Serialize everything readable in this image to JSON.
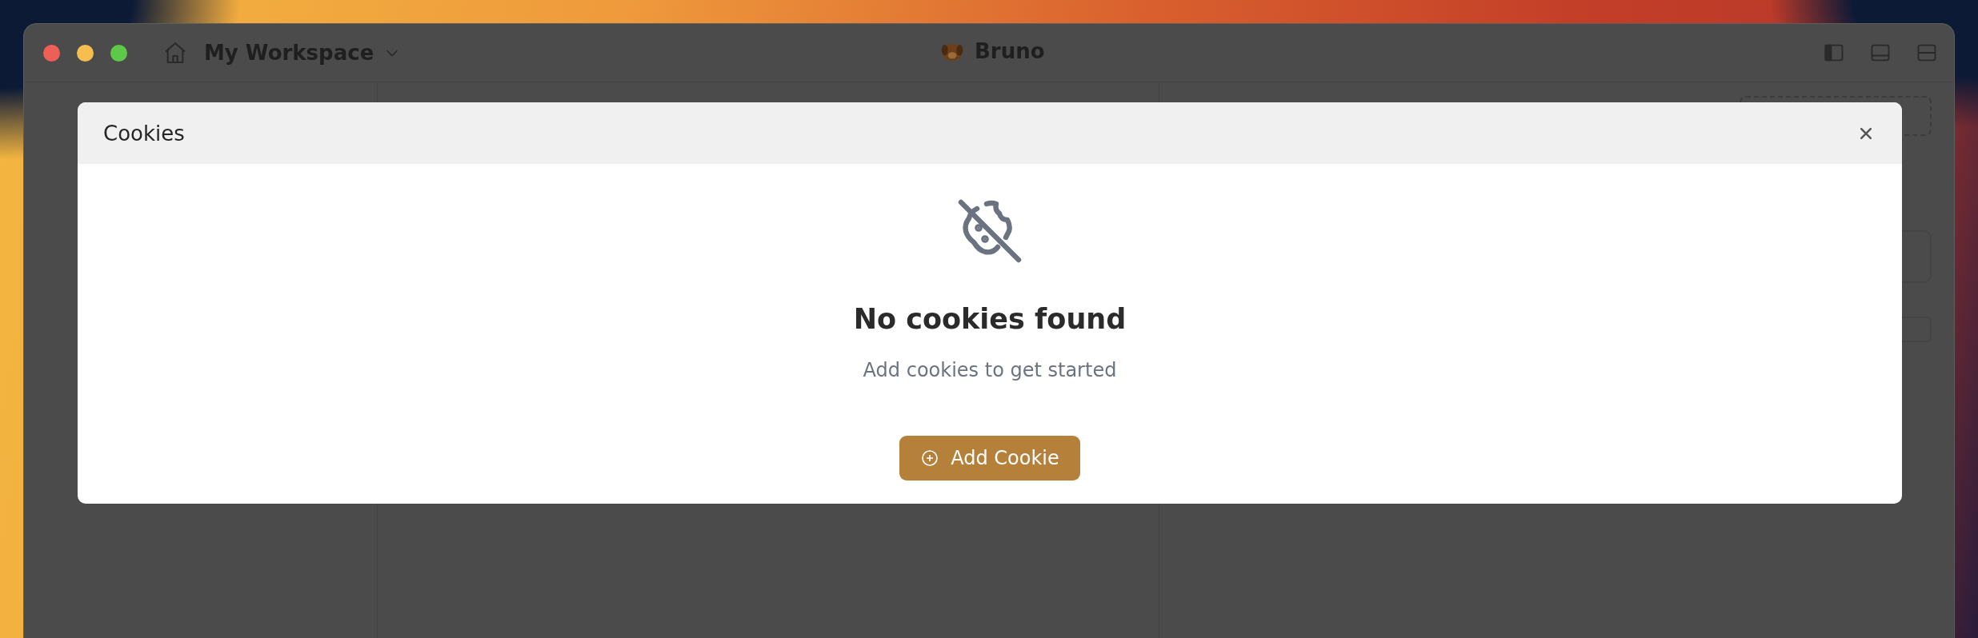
{
  "window": {
    "workspace": "My Workspace",
    "app_title": "Bruno"
  },
  "dialog": {
    "title": "Cookies",
    "empty_state": {
      "heading": "No cookies found",
      "message": "Add cookies to get started"
    },
    "primary_button": {
      "label": "Add Cookie"
    }
  }
}
